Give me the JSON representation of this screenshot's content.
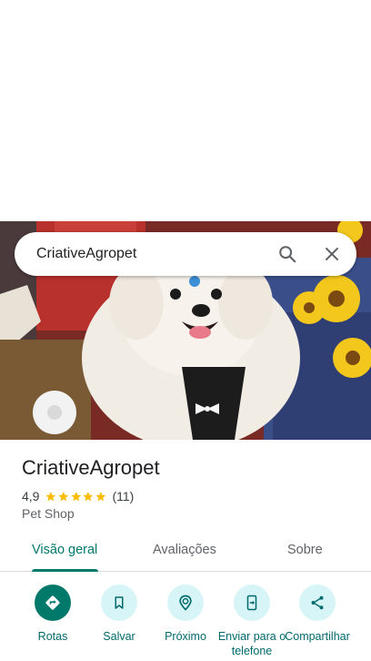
{
  "search": {
    "query": "CriativeAgropet"
  },
  "place": {
    "name": "CriativeAgropet",
    "rating": "4,9",
    "stars": 4.9,
    "review_count": "(11)",
    "category": "Pet Shop"
  },
  "tabs": [
    {
      "label": "Visão geral",
      "selected": true
    },
    {
      "label": "Avaliações",
      "selected": false
    },
    {
      "label": "Sobre",
      "selected": false
    }
  ],
  "actions": [
    {
      "label": "Rotas",
      "icon": "directions-icon"
    },
    {
      "label": "Salvar",
      "icon": "bookmark-icon"
    },
    {
      "label": "Próximo",
      "icon": "nearby-icon"
    },
    {
      "label": "Enviar para o telefone",
      "icon": "send-to-phone-icon"
    },
    {
      "label": "Compartilhar",
      "icon": "share-icon"
    }
  ],
  "colors": {
    "accent": "#00796b",
    "action_bg": "#d7f5f7",
    "star": "#fbbc04"
  }
}
